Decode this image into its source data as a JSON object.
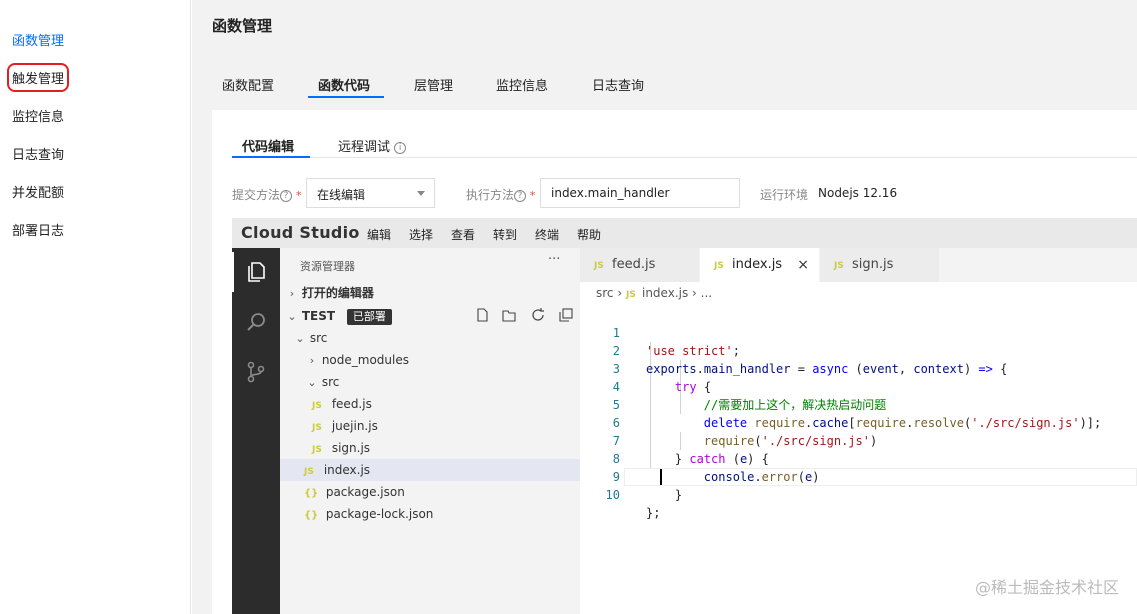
{
  "sidebar": {
    "items": [
      {
        "label": "函数管理"
      },
      {
        "label": "触发管理"
      },
      {
        "label": "监控信息"
      },
      {
        "label": "日志查询"
      },
      {
        "label": "并发配额"
      },
      {
        "label": "部署日志"
      }
    ]
  },
  "page": {
    "title": "函数管理"
  },
  "main_tabs": [
    {
      "label": "函数配置"
    },
    {
      "label": "函数代码"
    },
    {
      "label": "层管理"
    },
    {
      "label": "监控信息"
    },
    {
      "label": "日志查询"
    }
  ],
  "sub_tabs": [
    {
      "label": "代码编辑"
    },
    {
      "label": "远程调试"
    }
  ],
  "form": {
    "submit_label": "提交方法",
    "submit_value": "在线编辑",
    "handler_label": "执行方法",
    "handler_value": "index.main_handler",
    "runtime_label": "运行环境",
    "runtime_value": "Nodejs 12.16"
  },
  "ide": {
    "brand": "Cloud Studio",
    "menu": [
      "编辑",
      "选择",
      "查看",
      "转到",
      "终端",
      "帮助"
    ],
    "explorer": {
      "title": "资源管理器",
      "more": "···",
      "open_editors": "打开的编辑器",
      "workspace": "TEST",
      "badge": "已部署",
      "tree": [
        {
          "label": "src",
          "kind": "folder-open"
        },
        {
          "label": "node_modules",
          "kind": "folder-closed"
        },
        {
          "label": "src",
          "kind": "folder-open"
        },
        {
          "label": "feed.js",
          "kind": "js"
        },
        {
          "label": "juejin.js",
          "kind": "js"
        },
        {
          "label": "sign.js",
          "kind": "js"
        },
        {
          "label": "index.js",
          "kind": "js"
        },
        {
          "label": "package.json",
          "kind": "json"
        },
        {
          "label": "package-lock.json",
          "kind": "json"
        }
      ]
    },
    "tabs": [
      {
        "label": "feed.js"
      },
      {
        "label": "index.js"
      },
      {
        "label": "sign.js"
      }
    ],
    "breadcrumbs": {
      "part1": "src",
      "part2": "index.js",
      "part3": "..."
    },
    "code_lines": [
      "1",
      "2",
      "3",
      "4",
      "5",
      "6",
      "7",
      "8",
      "9",
      "10"
    ]
  },
  "watermark": "@稀土掘金技术社区"
}
